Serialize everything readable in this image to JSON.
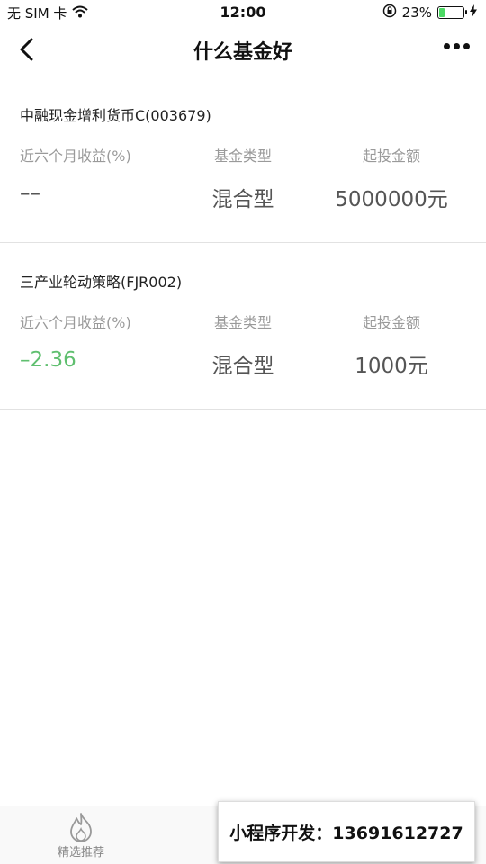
{
  "status_bar": {
    "carrier": "无 SIM 卡",
    "time": "12:00",
    "battery_percent": "23%",
    "battery_level": 0.23,
    "battery_color": "#4cd964"
  },
  "nav": {
    "title": "什么基金好"
  },
  "funds": [
    {
      "name": "中融现金增利货币C(003679)",
      "return_label": "近六个月收益(%)",
      "return_value": "––",
      "type_label": "基金类型",
      "type_value": "混合型",
      "min_label": "起投金额",
      "min_value": "5000000元"
    },
    {
      "name": "三产业轮动策略(FJR002)",
      "return_label": "近六个月收益(%)",
      "return_value": "–2.36",
      "type_label": "基金类型",
      "type_value": "混合型",
      "min_label": "起投金额",
      "min_value": "1000元"
    }
  ],
  "tabbar": {
    "tab1_label": "精选推荐"
  },
  "overlay": {
    "text": "小程序开发：13691612727"
  },
  "colors": {
    "negative_return": "#5fbf6f"
  }
}
